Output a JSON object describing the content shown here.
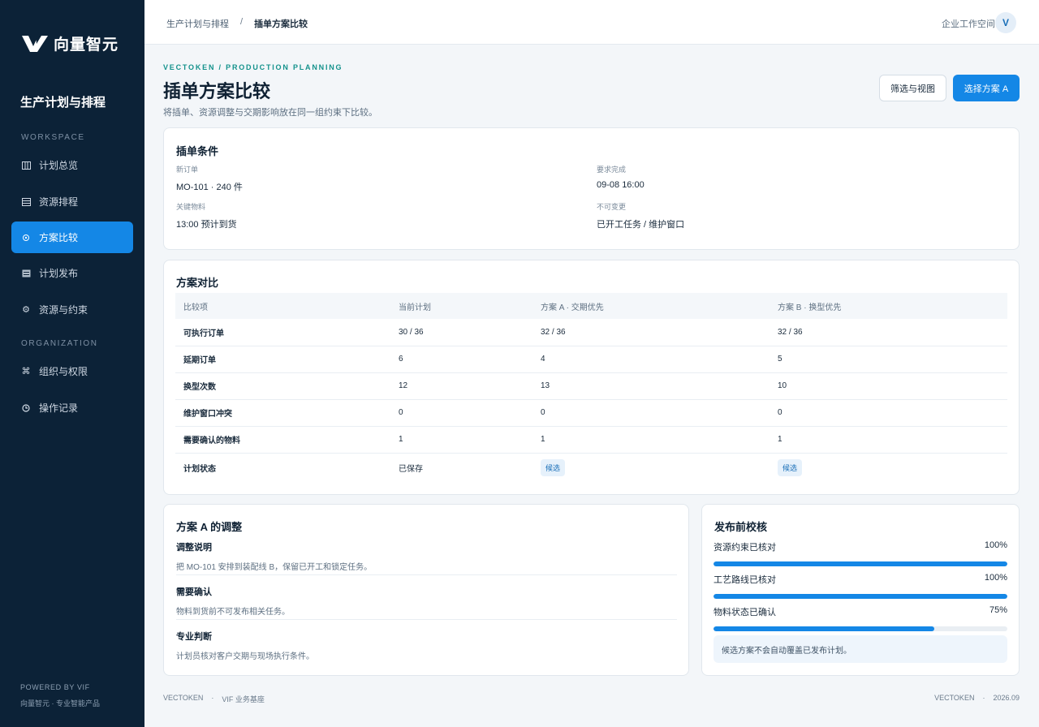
{
  "brand": {
    "name": "向量智元",
    "product": "生产计划与排程"
  },
  "sidebar": {
    "workspace_label": "WORKSPACE",
    "organization_label": "ORGANIZATION",
    "items": [
      {
        "label": "计划总览",
        "icon": "columns-icon"
      },
      {
        "label": "资源排程",
        "icon": "list-icon"
      },
      {
        "label": "方案比较",
        "icon": "target-icon"
      },
      {
        "label": "计划发布",
        "icon": "document-icon"
      },
      {
        "label": "资源与约束",
        "icon": "gear-icon"
      },
      {
        "label": "组织与权限",
        "icon": "command-icon"
      },
      {
        "label": "操作记录",
        "icon": "clock-icon"
      }
    ],
    "active": 2,
    "powered": "POWERED BY VIF",
    "powered_sub": "向量智元 · 专业智能产品"
  },
  "topbar": {
    "breadcrumb": [
      "生产计划与排程",
      "插单方案比较"
    ],
    "separator": "/",
    "workspace": "企业工作空间",
    "avatar": "V"
  },
  "header": {
    "eyebrow": "VECTOKEN / PRODUCTION PLANNING",
    "title": "插单方案比较",
    "subtitle": "将插单、资源调整与交期影响放在同一组约束下比较。",
    "filter_button": "筛选与视图",
    "primary_button": "选择方案 A"
  },
  "conditions": {
    "title": "插单条件",
    "fields": [
      {
        "label": "新订单",
        "value": "MO-101 · 240 件"
      },
      {
        "label": "要求完成",
        "value": "09-08 16:00"
      },
      {
        "label": "关键物料",
        "value": "13:00 预计到货"
      },
      {
        "label": "不可变更",
        "value": "已开工任务 / 维护窗口"
      }
    ]
  },
  "comparison": {
    "title": "方案对比",
    "headers": [
      "比较项",
      "当前计划",
      "方案 A · 交期优先",
      "方案 B · 换型优先"
    ],
    "rows": [
      [
        "可执行订单",
        "30 / 36",
        "32 / 36",
        "32 / 36"
      ],
      [
        "延期订单",
        "6",
        "4",
        "5"
      ],
      [
        "换型次数",
        "12",
        "13",
        "10"
      ],
      [
        "维护窗口冲突",
        "0",
        "0",
        "0"
      ],
      [
        "需要确认的物料",
        "1",
        "1",
        "1"
      ]
    ],
    "status_row": {
      "label": "计划状态",
      "current": "已保存",
      "a": "候选",
      "b": "候选"
    }
  },
  "adjustments": {
    "title": "方案 A 的调整",
    "items": [
      {
        "title": "调整说明",
        "desc": "把 MO-101 安排到装配线 B，保留已开工和锁定任务。"
      },
      {
        "title": "需要确认",
        "desc": "物料到货前不可发布相关任务。"
      },
      {
        "title": "专业判断",
        "desc": "计划员核对客户交期与现场执行条件。"
      }
    ]
  },
  "checks": {
    "title": "发布前校核",
    "items": [
      {
        "label": "资源约束已核对",
        "value": "100%",
        "percent": 100
      },
      {
        "label": "工艺路线已核对",
        "value": "100%",
        "percent": 100
      },
      {
        "label": "物料状态已确认",
        "value": "75%",
        "percent": 75
      }
    ],
    "note": "候选方案不会自动覆盖已发布计划。"
  },
  "footer": {
    "left": [
      "VECTOKEN",
      "·",
      "VIF 业务基座"
    ],
    "right": [
      "VECTOKEN",
      "·",
      "2026.09"
    ]
  },
  "colors": {
    "sidebar": "#0c2237",
    "accent": "#1487e6",
    "eyebrow": "#14928c"
  }
}
